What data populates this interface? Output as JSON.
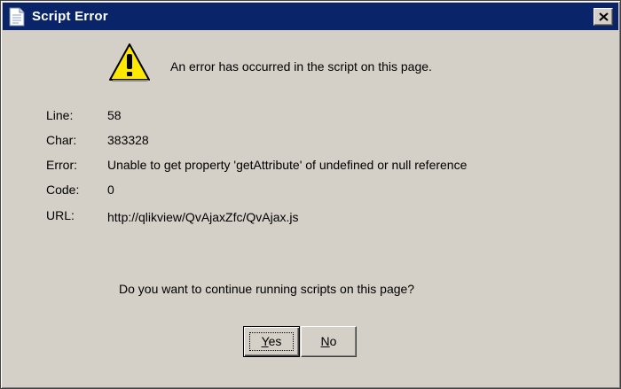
{
  "window": {
    "title": "Script Error"
  },
  "message": {
    "headline": "An error has occurred in the script on this page."
  },
  "details": [
    {
      "label": "Line:",
      "value": "58"
    },
    {
      "label": "Char:",
      "value": "383328"
    },
    {
      "label": "Error:",
      "value": "Unable to get property 'getAttribute' of undefined or null reference"
    },
    {
      "label": "Code:",
      "value": "0"
    },
    {
      "label": "URL:",
      "value": "http://qlikview/QvAjaxZfc/QvAjax.js"
    }
  ],
  "question": "Do you want to continue running scripts on this page?",
  "buttons": {
    "yes_mnemonic": "Y",
    "yes_rest": "es",
    "no_mnemonic": "N",
    "no_rest": "o"
  },
  "icons": {
    "title": "document-icon",
    "warning": "warning-icon",
    "close": "close-icon"
  },
  "colors": {
    "titlebar": "#0a246a",
    "dialog_bg": "#d4d0c8",
    "warning_yellow": "#ffe800"
  }
}
